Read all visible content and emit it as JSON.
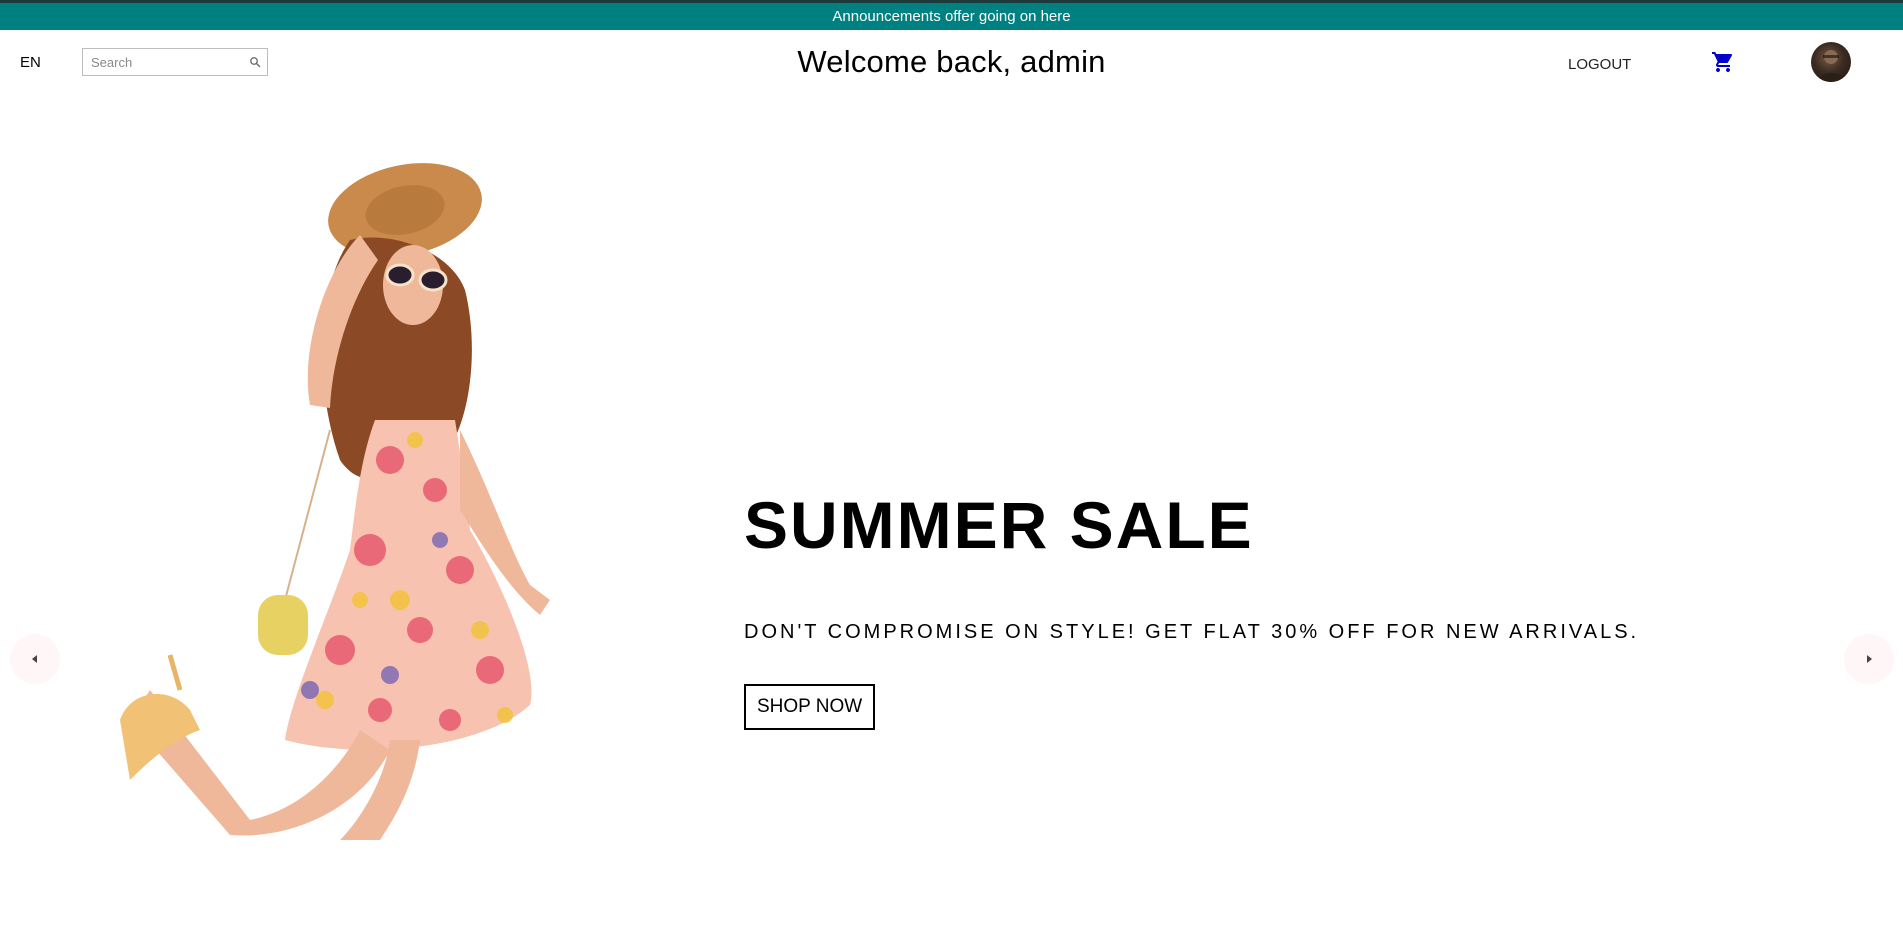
{
  "announcement": {
    "text": "Announcements offer going on here"
  },
  "header": {
    "language": "EN",
    "search": {
      "placeholder": "Search",
      "value": ""
    },
    "title": "Welcome back, admin",
    "logout_label": "LOGOUT",
    "cart_icon": "shopping-cart-icon",
    "avatar_icon": "user-avatar"
  },
  "hero": {
    "title": "SUMMER SALE",
    "description": "DON'T COMPROMISE ON STYLE! GET FLAT 30% OFF FOR NEW ARRIVALS.",
    "button_label": "SHOP NOW",
    "image": "woman-in-floral-summer-dress"
  },
  "slider": {
    "prev_icon": "arrow-left-icon",
    "next_icon": "arrow-right-icon"
  },
  "colors": {
    "announcement_bg": "#008080",
    "cart_icon": "#0000cc",
    "arrow_bg": "#fff7f7"
  }
}
